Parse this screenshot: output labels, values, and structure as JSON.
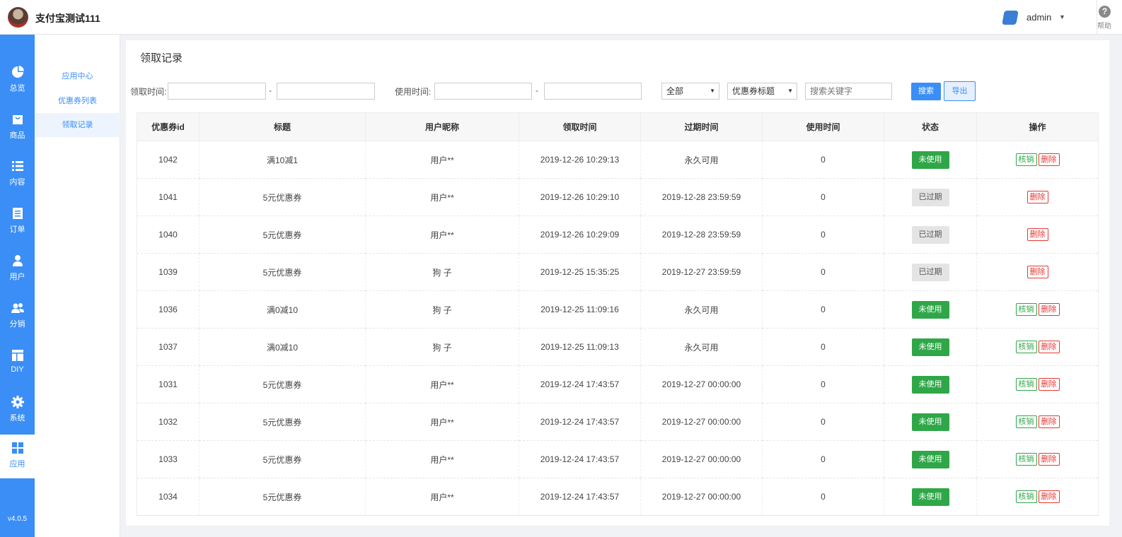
{
  "header": {
    "app_title": "支付宝测试111",
    "user_name": "admin",
    "help_label": "帮助"
  },
  "left_nav": [
    {
      "label": "总览",
      "icon": "pie-chart-icon"
    },
    {
      "label": "商品",
      "icon": "shopping-bag-icon"
    },
    {
      "label": "内容",
      "icon": "list-icon"
    },
    {
      "label": "订单",
      "icon": "document-icon"
    },
    {
      "label": "用户",
      "icon": "user-icon"
    },
    {
      "label": "分销",
      "icon": "users-icon"
    },
    {
      "label": "DIY",
      "icon": "layout-icon"
    },
    {
      "label": "系统",
      "icon": "gear-icon"
    },
    {
      "label": "应用",
      "icon": "grid-icon"
    }
  ],
  "version": "v4.0.5",
  "sub_nav": [
    "应用中心",
    "优惠券列表",
    "领取记录"
  ],
  "page_title": "领取记录",
  "filters": {
    "receive_time_label": "领取时间:",
    "use_time_label": "使用时间:",
    "dash": "-",
    "status_select": "全部",
    "field_select": "优惠券标题",
    "search_placeholder": "搜索关键字",
    "search_button": "搜索",
    "export_button": "导出"
  },
  "table": {
    "columns": [
      "优惠券id",
      "标题",
      "用户昵称",
      "领取时间",
      "过期时间",
      "使用时间",
      "状态",
      "操作"
    ],
    "rows": [
      {
        "id": "1042",
        "title": "满10减1",
        "user": "用户**",
        "received": "2019-12-26 10:29:13",
        "expires": "永久可用",
        "used": "0",
        "status": "未使用",
        "status_type": "unused",
        "actions": [
          "核销",
          "删除"
        ]
      },
      {
        "id": "1041",
        "title": "5元优惠券",
        "user": "用户**",
        "received": "2019-12-26 10:29:10",
        "expires": "2019-12-28 23:59:59",
        "used": "0",
        "status": "已过期",
        "status_type": "expired",
        "actions": [
          "删除"
        ]
      },
      {
        "id": "1040",
        "title": "5元优惠券",
        "user": "用户**",
        "received": "2019-12-26 10:29:09",
        "expires": "2019-12-28 23:59:59",
        "used": "0",
        "status": "已过期",
        "status_type": "expired",
        "actions": [
          "删除"
        ]
      },
      {
        "id": "1039",
        "title": "5元优惠券",
        "user": "狗 子",
        "received": "2019-12-25 15:35:25",
        "expires": "2019-12-27 23:59:59",
        "used": "0",
        "status": "已过期",
        "status_type": "expired",
        "actions": [
          "删除"
        ]
      },
      {
        "id": "1036",
        "title": "满0减10",
        "user": "狗 子",
        "received": "2019-12-25 11:09:16",
        "expires": "永久可用",
        "used": "0",
        "status": "未使用",
        "status_type": "unused",
        "actions": [
          "核销",
          "删除"
        ]
      },
      {
        "id": "1037",
        "title": "满0减10",
        "user": "狗 子",
        "received": "2019-12-25 11:09:13",
        "expires": "永久可用",
        "used": "0",
        "status": "未使用",
        "status_type": "unused",
        "actions": [
          "核销",
          "删除"
        ]
      },
      {
        "id": "1031",
        "title": "5元优惠券",
        "user": "用户**",
        "received": "2019-12-24 17:43:57",
        "expires": "2019-12-27 00:00:00",
        "used": "0",
        "status": "未使用",
        "status_type": "unused",
        "actions": [
          "核销",
          "删除"
        ]
      },
      {
        "id": "1032",
        "title": "5元优惠券",
        "user": "用户**",
        "received": "2019-12-24 17:43:57",
        "expires": "2019-12-27 00:00:00",
        "used": "0",
        "status": "未使用",
        "status_type": "unused",
        "actions": [
          "核销",
          "删除"
        ]
      },
      {
        "id": "1033",
        "title": "5元优惠券",
        "user": "用户**",
        "received": "2019-12-24 17:43:57",
        "expires": "2019-12-27 00:00:00",
        "used": "0",
        "status": "未使用",
        "status_type": "unused",
        "actions": [
          "核销",
          "删除"
        ]
      },
      {
        "id": "1034",
        "title": "5元优惠券",
        "user": "用户**",
        "received": "2019-12-24 17:43:57",
        "expires": "2019-12-27 00:00:00",
        "used": "0",
        "status": "未使用",
        "status_type": "unused",
        "actions": [
          "核销",
          "删除"
        ]
      }
    ]
  },
  "colors": {
    "primary": "#3a8ef6",
    "success": "#2fa748",
    "danger": "#e53935",
    "muted_badge": "#e4e4e4"
  }
}
